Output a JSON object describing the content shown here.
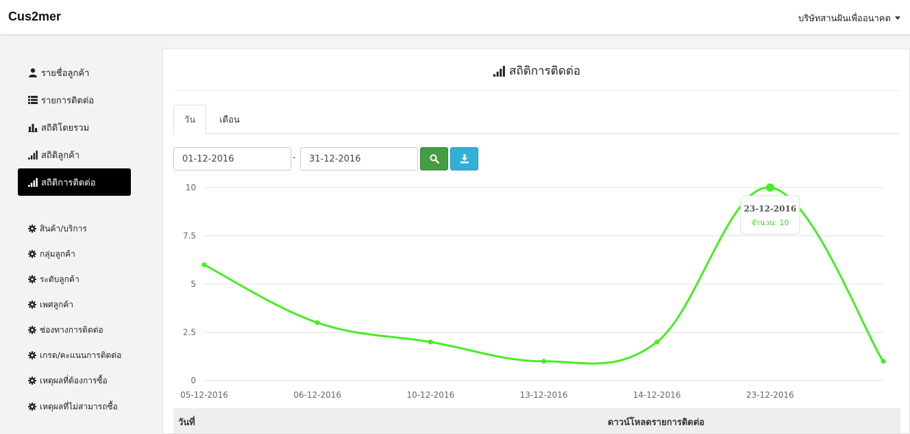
{
  "header": {
    "brand": "Cus2mer",
    "company": "บริษัทสานฝันเพื่ออนาคต"
  },
  "sidebar": {
    "main_items": [
      {
        "label": "รายชื่อลูกค้า",
        "icon": "user-icon"
      },
      {
        "label": "รายการติดต่อ",
        "icon": "list-icon"
      },
      {
        "label": "สถิติโดยรวม",
        "icon": "bar-chart-icon"
      },
      {
        "label": "สถิติลูกค้า",
        "icon": "signal-icon"
      },
      {
        "label": "สถิติการติดต่อ",
        "icon": "signal-icon",
        "active": true
      }
    ],
    "config_items": [
      {
        "label": "สินค้า/บริการ",
        "icon": "gear-icon"
      },
      {
        "label": "กลุ่มลูกค้า",
        "icon": "gear-icon"
      },
      {
        "label": "ระดับลูกค้า",
        "icon": "gear-icon"
      },
      {
        "label": "เพศลูกค้า",
        "icon": "gear-icon"
      },
      {
        "label": "ช่องทางการติดต่อ",
        "icon": "gear-icon"
      },
      {
        "label": "เกรด/คะแนนการติดต่อ",
        "icon": "gear-icon"
      },
      {
        "label": "เหตุผลที่ต้องการซื้อ",
        "icon": "gear-icon"
      },
      {
        "label": "เหตุผลที่ไม่สามารถซื้อ",
        "icon": "gear-icon"
      }
    ]
  },
  "panel": {
    "title": "สถิติการติดต่อ",
    "tabs": [
      {
        "label": "วัน",
        "active": true
      },
      {
        "label": "เดือน"
      }
    ],
    "date_from": "01-12-2016",
    "date_separator": "-",
    "date_to": "31-12-2016",
    "table_headers": {
      "date": "วันที่",
      "download": "ดาวน์โหลดรายการติดต่อ"
    }
  },
  "chart_data": {
    "type": "line",
    "x": [
      "05-12-2016",
      "06-12-2016",
      "10-12-2016",
      "13-12-2016",
      "14-12-2016",
      "23-12-2016",
      ""
    ],
    "y_ticks": [
      "0",
      "2.5",
      "5",
      "7.5",
      "10"
    ],
    "ylim": [
      0,
      10
    ],
    "series": [
      {
        "values": [
          6,
          3,
          2,
          1,
          2,
          10,
          1
        ]
      }
    ],
    "tooltip": {
      "date": "23-12-2016",
      "label": "จำนวน: 10",
      "index": 5
    },
    "colors": {
      "line": "#44ee22",
      "grid": "#e0e0e0",
      "tooltip_text": "#33dd22"
    },
    "grid": true,
    "legend": "none"
  },
  "colors": {
    "active_nav": "#000000",
    "search_button": "#449d44",
    "download_button": "#31b0d5"
  }
}
